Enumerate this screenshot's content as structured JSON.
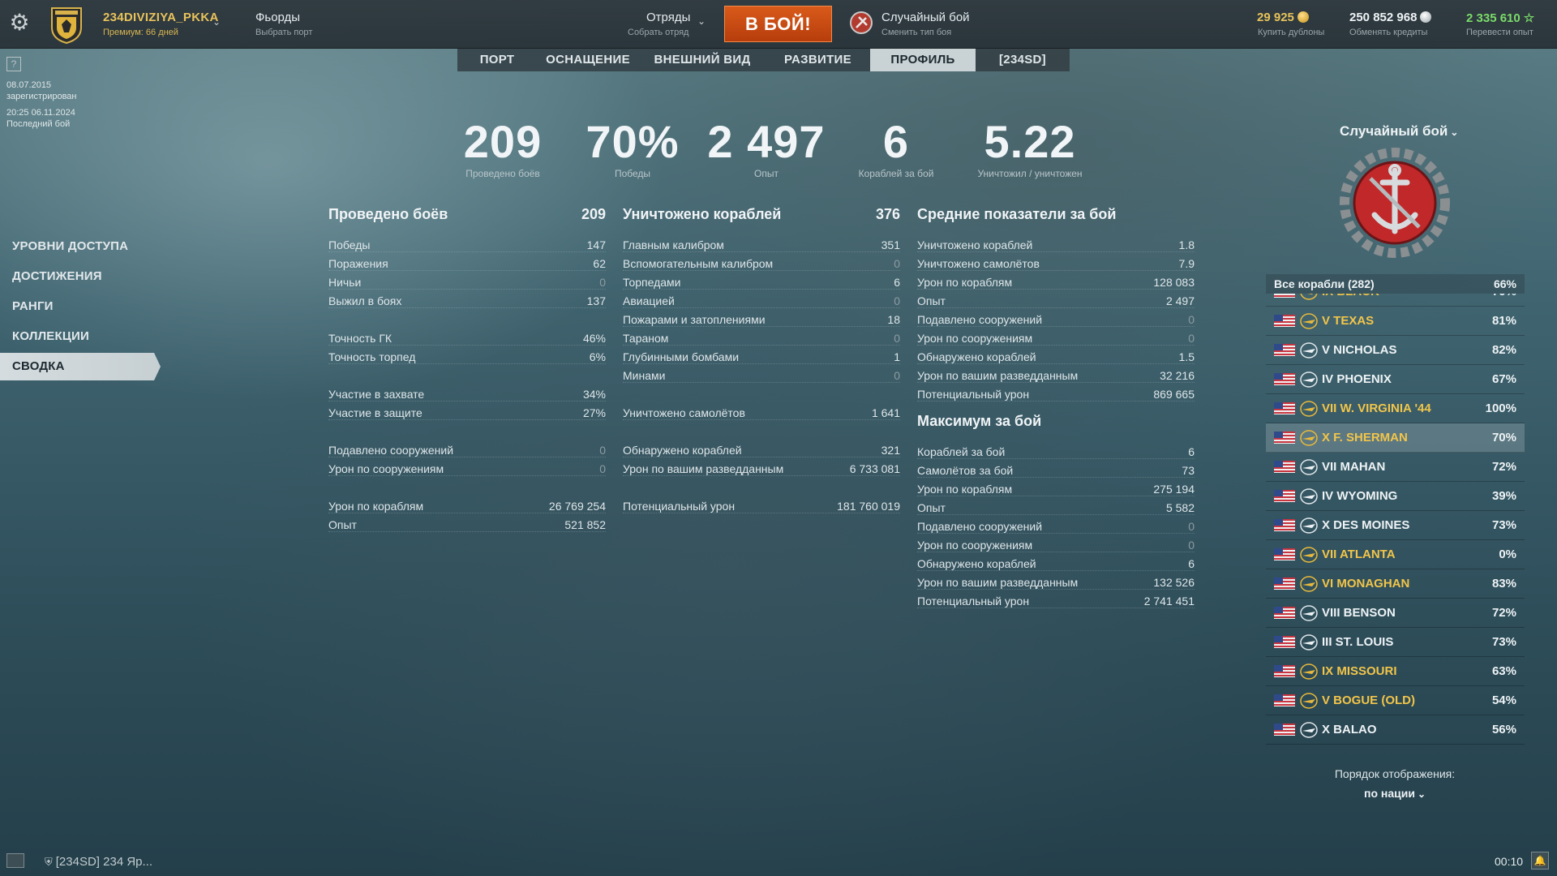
{
  "header": {
    "player_name": "234DIVIZIYA_PKKA",
    "premium": "Премиум: 66 дней",
    "port_name": "Фьорды",
    "port_sub": "Выбрать порт",
    "squads": "Отряды",
    "squads_sub": "Собрать отряд",
    "battle_button": "В БОЙ!",
    "mode_name": "Случайный бой",
    "mode_sub": "Сменить тип боя",
    "doubloons": "29 925",
    "doubloons_sub": "Купить дублоны",
    "credits": "250 852 968",
    "credits_sub": "Обменять кредиты",
    "free_xp": "2 335 610",
    "free_xp_sub": "Перевести опыт",
    "colors": {
      "gold": "#e8c35a",
      "battle": "#c8480f",
      "freexp": "#7bdc6a"
    }
  },
  "tabs": [
    {
      "label": "ПОРТ",
      "active": false
    },
    {
      "label": "ОСНАЩЕНИЕ",
      "active": false
    },
    {
      "label": "ВНЕШНИЙ ВИД",
      "active": false
    },
    {
      "label": "РАЗВИТИЕ",
      "active": false
    },
    {
      "label": "ПРОФИЛЬ",
      "active": true
    },
    {
      "label": "[234SD]",
      "active": false
    }
  ],
  "account": {
    "registered_date": "08.07.2015",
    "registered_label": "зарегистрирован",
    "last_battle_date": "20:25  06.11.2024",
    "last_battle_label": "Последний бой"
  },
  "side_menu": [
    {
      "label": "УРОВНИ ДОСТУПА",
      "active": false
    },
    {
      "label": "ДОСТИЖЕНИЯ",
      "active": false
    },
    {
      "label": "РАНГИ",
      "active": false
    },
    {
      "label": "КОЛЛЕКЦИИ",
      "active": false
    },
    {
      "label": "СВОДКА",
      "active": true
    }
  ],
  "big_stats": [
    {
      "value": "209",
      "label": "Проведено боёв"
    },
    {
      "value": "70%",
      "label": "Победы"
    },
    {
      "value": "2 497",
      "label": "Опыт"
    },
    {
      "value": "6",
      "label": "Кораблей за бой"
    },
    {
      "value": "5.22",
      "label": "Уничтожил / уничтожен"
    }
  ],
  "col1": {
    "title": "Проведено боёв",
    "total": "209",
    "rows": [
      {
        "label": "Победы",
        "value": "147"
      },
      {
        "label": "Поражения",
        "value": "62"
      },
      {
        "label": "Ничьи",
        "value": "0"
      },
      {
        "label": "Выжил в боях",
        "value": "137"
      },
      null,
      {
        "label": "Точность ГК",
        "value": "46%"
      },
      {
        "label": "Точность торпед",
        "value": "6%"
      },
      null,
      {
        "label": "Участие в захвате",
        "value": "34%"
      },
      {
        "label": "Участие в защите",
        "value": "27%"
      },
      null,
      {
        "label": "Подавлено сооружений",
        "value": "0"
      },
      {
        "label": "Урон по сооружениям",
        "value": "0"
      },
      null,
      {
        "label": "Урон по кораблям",
        "value": "26 769 254"
      },
      {
        "label": "Опыт",
        "value": "521 852"
      }
    ]
  },
  "col2": {
    "title": "Уничтожено кораблей",
    "total": "376",
    "rows": [
      {
        "label": "Главным калибром",
        "value": "351"
      },
      {
        "label": "Вспомогательным калибром",
        "value": "0"
      },
      {
        "label": "Торпедами",
        "value": "6"
      },
      {
        "label": "Авиацией",
        "value": "0"
      },
      {
        "label": "Пожарами и затоплениями",
        "value": "18"
      },
      {
        "label": "Тараном",
        "value": "0"
      },
      {
        "label": "Глубинными бомбами",
        "value": "1"
      },
      {
        "label": "Минами",
        "value": "0"
      },
      null,
      {
        "label": "Уничтожено самолётов",
        "value": "1 641"
      },
      null,
      {
        "label": "Обнаружено кораблей",
        "value": "321"
      },
      {
        "label": "Урон по вашим разведданным",
        "value": "6 733 081"
      },
      null,
      {
        "label": "Потенциальный урон",
        "value": "181 760 019"
      }
    ]
  },
  "col3": {
    "title": "Средние показатели за бой",
    "rows": [
      {
        "label": "Уничтожено кораблей",
        "value": "1.8"
      },
      {
        "label": "Уничтожено самолётов",
        "value": "7.9"
      },
      {
        "label": "Урон по кораблям",
        "value": "128 083"
      },
      {
        "label": "Опыт",
        "value": "2 497"
      },
      {
        "label": "Подавлено сооружений",
        "value": "0"
      },
      {
        "label": "Урон по сооружениям",
        "value": "0"
      },
      {
        "label": "Обнаружено кораблей",
        "value": "1.5"
      },
      {
        "label": "Урон по вашим разведданным",
        "value": "32 216"
      },
      {
        "label": "Потенциальный урон",
        "value": "869 665"
      }
    ],
    "max_title": "Максимум за бой",
    "max_rows": [
      {
        "label": "Кораблей за бой",
        "value": "6"
      },
      {
        "label": "Самолётов за бой",
        "value": "73"
      },
      {
        "label": "Урон по кораблям",
        "value": "275 194"
      },
      {
        "label": "Опыт",
        "value": "5 582"
      },
      {
        "label": "Подавлено сооружений",
        "value": "0"
      },
      {
        "label": "Урон по сооружениям",
        "value": "0"
      },
      {
        "label": "Обнаружено кораблей",
        "value": "6"
      },
      {
        "label": "Урон по вашим разведданным",
        "value": "132 526"
      },
      {
        "label": "Потенциальный урон",
        "value": "2 741 451"
      }
    ]
  },
  "right": {
    "mode_title": "Случайный бой",
    "all_ships_label": "Все корабли (282)",
    "all_ships_pct": "66%",
    "ships": [
      {
        "name": "IX BLACK",
        "pct": "70%",
        "gold": true,
        "selected": false
      },
      {
        "name": "V TEXAS",
        "pct": "81%",
        "gold": true,
        "selected": false
      },
      {
        "name": "V NICHOLAS",
        "pct": "82%",
        "gold": false,
        "selected": false
      },
      {
        "name": "IV PHOENIX",
        "pct": "67%",
        "gold": false,
        "selected": false
      },
      {
        "name": "VII W. VIRGINIA '44",
        "pct": "100%",
        "gold": true,
        "selected": false
      },
      {
        "name": "X F. SHERMAN",
        "pct": "70%",
        "gold": true,
        "selected": true
      },
      {
        "name": "VII MAHAN",
        "pct": "72%",
        "gold": false,
        "selected": false
      },
      {
        "name": "IV WYOMING",
        "pct": "39%",
        "gold": false,
        "selected": false
      },
      {
        "name": "X DES MOINES",
        "pct": "73%",
        "gold": false,
        "selected": false
      },
      {
        "name": "VII ATLANTA",
        "pct": "0%",
        "gold": true,
        "selected": false
      },
      {
        "name": "VI MONAGHAN",
        "pct": "83%",
        "gold": true,
        "selected": false
      },
      {
        "name": "VIII BENSON",
        "pct": "72%",
        "gold": false,
        "selected": false
      },
      {
        "name": "III ST. LOUIS",
        "pct": "73%",
        "gold": false,
        "selected": false
      },
      {
        "name": "IX MISSOURI",
        "pct": "63%",
        "gold": true,
        "selected": false
      },
      {
        "name": "V BOGUE (OLD)",
        "pct": "54%",
        "gold": true,
        "selected": false
      },
      {
        "name": "X BALAO",
        "pct": "56%",
        "gold": false,
        "selected": false
      }
    ],
    "order_label": "Порядок отображения:",
    "order_value": "по нации"
  },
  "footer": {
    "clan_chat": "[234SD] 234 Яр...",
    "clock": "00:10"
  }
}
